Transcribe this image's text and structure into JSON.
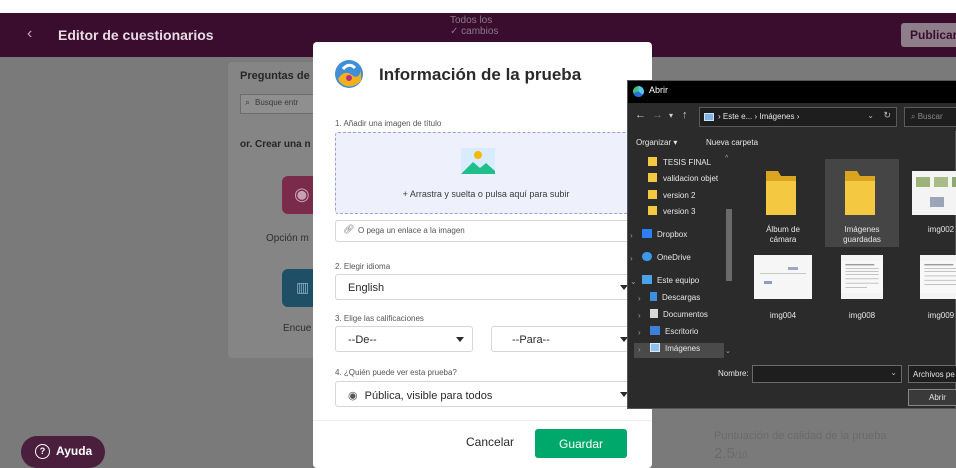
{
  "app_bar": {
    "back_glyph": "‹",
    "title": "Editor de cuestionarios",
    "save_status_line1": "Todos los",
    "save_status_line2": "✓ cambios",
    "publish_label": "Publicar"
  },
  "background": {
    "questions_heading": "Preguntas de t",
    "search_placeholder": "Busque entr",
    "create_heading": "or. Crear una n",
    "tile1_label": "Opción m",
    "tile2_label": "Encue",
    "quality_label": "Puntuación de calidad de la prueba",
    "quality_value": "2.5",
    "quality_max": "/10"
  },
  "help_button": {
    "label": "Ayuda"
  },
  "modal": {
    "title": "Información de la prueba",
    "step1_label": "1. Añadir una imagen de título",
    "dropzone_text": "+ Arrastra y suelta o pulsa aquí para subir",
    "link_placeholder": "O pega un enlace a la imagen",
    "step2_label": "2. Elegir idioma",
    "language_value": "English",
    "step3_label": "3. Elige las calificaciones",
    "from_grade_value": "--De--",
    "to_grade_value": "--Para--",
    "step4_label": "4. ¿Quién puede ver esta prueba?",
    "visibility_value": "Pública, visible para todos",
    "cancel_label": "Cancelar",
    "save_label": "Guardar"
  },
  "file_dialog": {
    "title": "Abrir",
    "address_parts": "›  Este e...  ›  Imágenes  ›",
    "search_placeholder": "Buscar",
    "organize_label": "Organizar ▾",
    "new_folder_label": "Nueva carpeta",
    "tree_items": [
      {
        "label": "TESIS FINAL",
        "icon": "folder-icon"
      },
      {
        "label": "validacion objet",
        "icon": "folder-icon"
      },
      {
        "label": "version 2",
        "icon": "folder-icon"
      },
      {
        "label": "version 3",
        "icon": "folder-icon"
      },
      {
        "label": "Dropbox",
        "icon": "dropbox-icon"
      },
      {
        "label": "OneDrive",
        "icon": "onedrive-icon"
      },
      {
        "label": "Este equipo",
        "icon": "pc-icon"
      },
      {
        "label": "Descargas",
        "icon": "download-icon"
      },
      {
        "label": "Documentos",
        "icon": "document-icon"
      },
      {
        "label": "Escritorio",
        "icon": "desktop-icon"
      },
      {
        "label": "Imágenes",
        "icon": "pictures-icon"
      }
    ],
    "files": [
      {
        "name_line1": "Álbum de",
        "name_line2": "cámara",
        "kind": "folder"
      },
      {
        "name_line1": "Imágenes",
        "name_line2": "guardadas",
        "kind": "folder"
      },
      {
        "name_line1": "img002",
        "name_line2": "",
        "kind": "image"
      },
      {
        "name_line1": "img004",
        "name_line2": "",
        "kind": "image"
      },
      {
        "name_line1": "img008",
        "name_line2": "",
        "kind": "image"
      },
      {
        "name_line1": "img009",
        "name_line2": "",
        "kind": "image"
      }
    ],
    "name_label": "Nombre:",
    "name_value": "",
    "filetype_label": "Archivos pe",
    "open_label": "Abrir"
  },
  "colors": {
    "app_bar": "#3a0d2f",
    "save_green": "#00a86b",
    "dropzone_bg": "#eef0fc",
    "folder_yellow": "#f5c842"
  }
}
